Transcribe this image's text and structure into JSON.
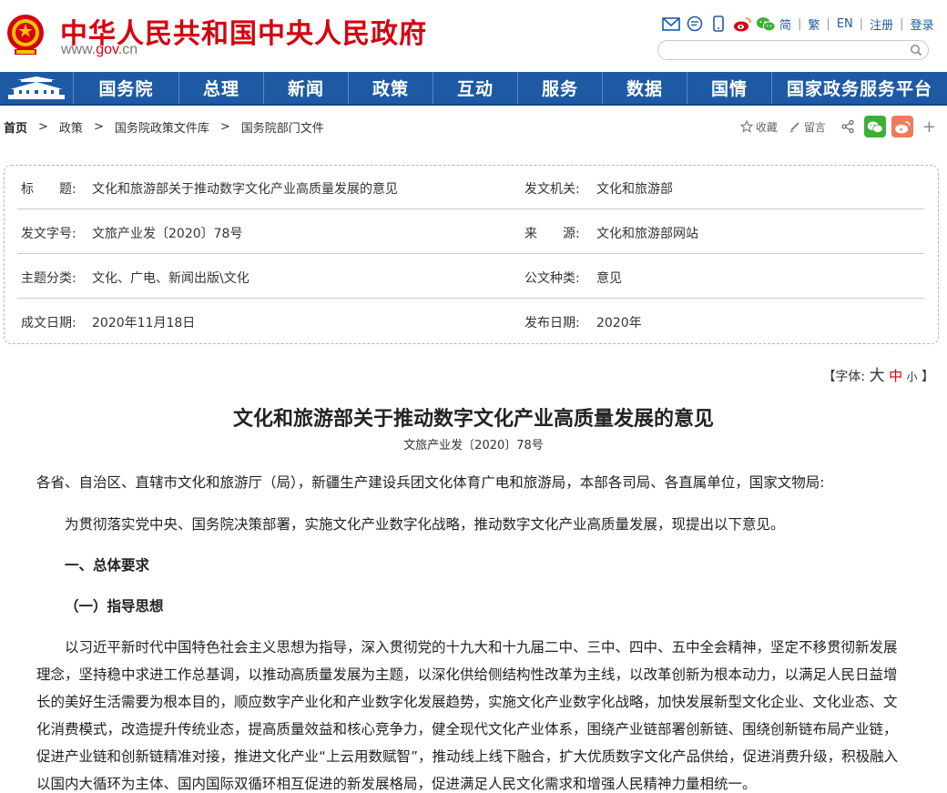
{
  "header": {
    "site_title": "中华人民共和国中央人民政府",
    "site_url_prefix": "www.",
    "site_url_domain": "gov",
    "site_url_suffix": ".cn",
    "lang_simplified": "简",
    "lang_traditional": "繁",
    "lang_english": "EN",
    "register": "注册",
    "login": "登录",
    "search_placeholder": ""
  },
  "nav": {
    "items": [
      "国务院",
      "总理",
      "新闻",
      "政策",
      "互动",
      "服务",
      "数据",
      "国情",
      "国家政务服务平台"
    ]
  },
  "breadcrumb": [
    "首页",
    "政策",
    "国务院政策文件库",
    "国务院部门文件"
  ],
  "tools": {
    "favorite": "收藏",
    "comment": "留言",
    "more": "+"
  },
  "info": {
    "title_label": "标　　题:",
    "title_value": "文化和旅游部关于推动数字文化产业高质量发展的意见",
    "issuer_label": "发文机关:",
    "issuer_value": "文化和旅游部",
    "docno_label": "发文字号:",
    "docno_value": "文旅产业发〔2020〕78号",
    "source_label": "来　　源:",
    "source_value": "文化和旅游部网站",
    "topic_label": "主题分类:",
    "topic_value": "文化、广电、新闻出版\\文化",
    "type_label": "公文种类:",
    "type_value": "意见",
    "date_label": "成文日期:",
    "date_value": "2020年11月18日",
    "pubdate_label": "发布日期:",
    "pubdate_value": "2020年"
  },
  "fontsize": {
    "open": "【字体:",
    "large": "大",
    "medium": "中",
    "small": "小",
    "close": "】"
  },
  "doc": {
    "title": "文化和旅游部关于推动数字文化产业高质量发展的意见",
    "number": "文旅产业发〔2020〕78号",
    "p1": "各省、自治区、直辖市文化和旅游厅（局），新疆生产建设兵团文化体育广电和旅游局，本部各司局、各直属单位，国家文物局:",
    "p2": "为贯彻落实党中央、国务院决策部署，实施文化产业数字化战略，推动数字文化产业高质量发展，现提出以下意见。",
    "h1": "一、总体要求",
    "h2": "（一）指导思想",
    "p3": "以习近平新时代中国特色社会主义思想为指导，深入贯彻党的十九大和十九届二中、三中、四中、五中全会精神，坚定不移贯彻新发展理念，坚持稳中求进工作总基调，以推动高质量发展为主题，以深化供给侧结构性改革为主线，以改革创新为根本动力，以满足人民日益增长的美好生活需要为根本目的，顺应数字产业化和产业数字化发展趋势，实施文化产业数字化战略，加快发展新型文化企业、文化业态、文化消费模式，改造提升传统业态，提高质量效益和核心竞争力，健全现代文化产业体系，围绕产业链部署创新链、围绕创新链布局产业链，促进产业链和创新链精准对接，推进文化产业“上云用数赋智”，推动线上线下融合，扩大优质数字文化产品供给，促进消费升级，积极融入以国内大循环为主体、国内国际双循环相互促进的新发展格局，促进满足人民文化需求和增强人民精神力量相统一。"
  },
  "colors": {
    "brand_red": "#d7000f",
    "nav_blue": "#1e5aa3",
    "wechat_green": "#3cb035",
    "weibo_orange": "#f07a5a"
  }
}
